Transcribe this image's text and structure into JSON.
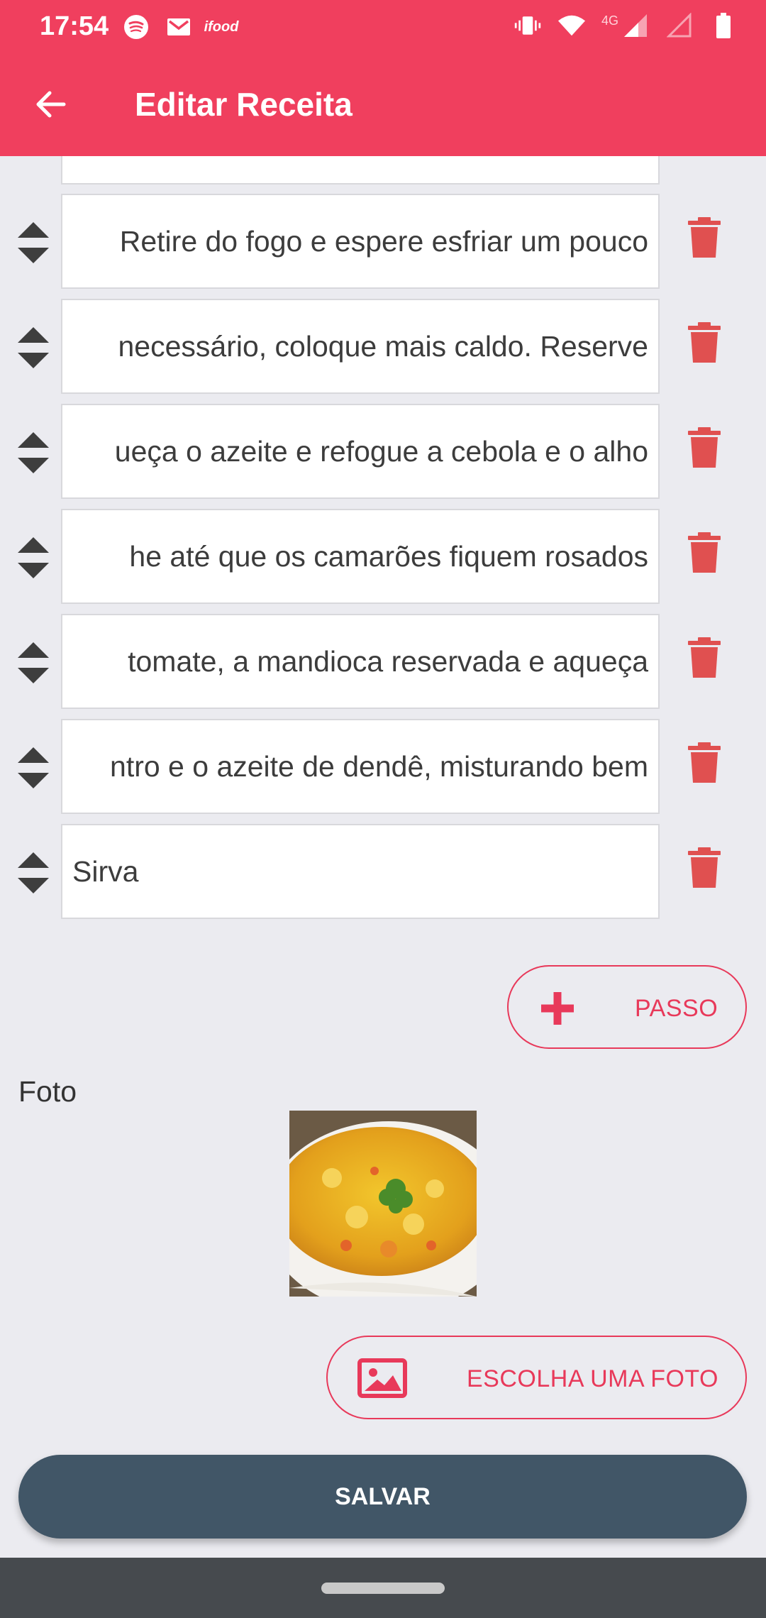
{
  "status_bar": {
    "time": "17:54",
    "left_icons": [
      "spotify-icon",
      "gmail-icon",
      "ifood-icon"
    ],
    "ifood_label": "ifood",
    "network_label": "4G",
    "right_icons": [
      "vibrate-icon",
      "wifi-icon",
      "signal-icon",
      "signal-empty-icon",
      "battery-icon"
    ]
  },
  "app_bar": {
    "title": "Editar Receita",
    "back_icon": "arrow-back-icon"
  },
  "steps": [
    {
      "text": "Retire do fogo e espere esfriar um pouco"
    },
    {
      "text": "necessário, coloque mais caldo. Reserve"
    },
    {
      "text": "ueça o azeite e refogue a cebola e o alho"
    },
    {
      "text": "he até que os camarões fiquem rosados"
    },
    {
      "text": " tomate, a mandioca reservada e aqueça"
    },
    {
      "text": "ntro e o azeite de dendê, misturando bem"
    },
    {
      "text": "Sirva"
    }
  ],
  "add_step_button": {
    "label": "PASSO",
    "icon": "plus-icon"
  },
  "photo_section": {
    "label": "Foto"
  },
  "choose_photo_button": {
    "label": "ESCOLHA UMA FOTO",
    "icon": "image-icon"
  },
  "save_button": {
    "label": "SALVAR"
  },
  "colors": {
    "primary": "#f03f5e",
    "accent": "#e8395a",
    "delete": "#e05050",
    "save": "#415667",
    "background": "#ebebf0"
  }
}
